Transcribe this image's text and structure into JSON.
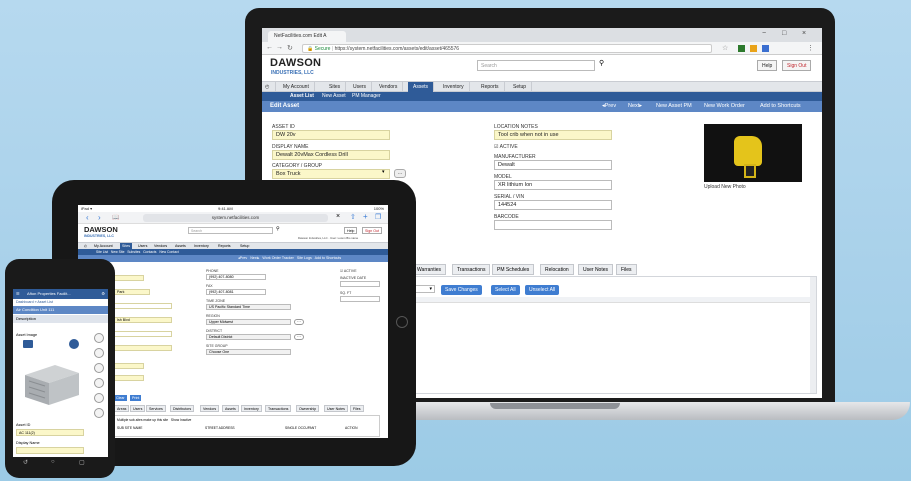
{
  "laptop": {
    "browser": {
      "tab_title": "NetFacilities.com Edit A",
      "url_secure": "Secure",
      "url": "https://system.netfacilities.com/assets/edit/asset/465576",
      "win_min": "−",
      "win_max": "□",
      "win_close": "×"
    },
    "header": {
      "logo_line1": "DAWSON",
      "logo_line2": "INDUSTRIES, LLC",
      "search_placeholder": "Search",
      "help": "Help",
      "sign_out": "Sign Out"
    },
    "nav_tabs": [
      "My Account",
      "Sites",
      "Users",
      "Vendors",
      "Assets",
      "Inventory",
      "Reports",
      "Setup"
    ],
    "subnav": [
      "Asset List",
      "New Asset",
      "PM Manager"
    ],
    "title_bar": {
      "title": "Edit Asset",
      "prev": "◂Prev",
      "next": "Next▸",
      "new_asset_pm": "New Asset PM",
      "new_work_order": "New Work Order",
      "add_shortcuts": "Add to Shortcuts"
    },
    "form": {
      "asset_id_label": "ASSET ID",
      "asset_id": "DW 20v",
      "display_name_label": "DISPLAY NAME",
      "display_name": "Dewalt 20vMax Cordless Drill",
      "category_label": "CATEGORY / GROUP",
      "category": "Box Truck",
      "location_notes_label": "LOCATION NOTES",
      "location_notes": "Tool crib when not in use",
      "active_label": "ACTIVE",
      "manufacturer_label": "MANUFACTURER",
      "manufacturer": "Dewalt",
      "model_label": "MODEL",
      "model": "XR lithium Ion",
      "serial_label": "SERIAL / VIN",
      "serial": "144524",
      "barcode_label": "BARCODE",
      "upload_photo": "Upload New Photo"
    },
    "tabs": [
      "Warranties",
      "Transactions",
      "PM Schedules",
      "Relocation",
      "User Notes",
      "Files"
    ],
    "buttons": {
      "save_changes": "Save Changes",
      "select_all": "Select All",
      "unselect_all": "Unselect All"
    }
  },
  "tablet": {
    "status_time": "9:41 AM",
    "status_left": "iPad ▾",
    "status_right": "100%",
    "url": "system.netfacilities.com",
    "logo_line1": "DAWSON",
    "logo_line2": "INDUSTRIES, LLC",
    "search_placeholder": "Search",
    "help": "Help",
    "sign_out": "Sign Out",
    "account_line": "Dawson Industries, LLC · User: Lorem Bio name",
    "nav": [
      "My Account",
      "Sites",
      "Users",
      "Vendors",
      "Assets",
      "Inventory",
      "Reports",
      "Setup"
    ],
    "subnav": "Site List   New Site   Subsites   Contacts   New Contact",
    "title_links": "◂Prev   Next▸   Work Order Tracker   Site Logs   Add to Shortcuts",
    "fields": {
      "phone_label": "PHONE",
      "phone": "(992) 407-8080",
      "fax_label": "FAX",
      "fax": "(992) 407-8081",
      "timezone_label": "TIME ZONE",
      "timezone": "US Pacific Standard Time",
      "region_label": "REGION",
      "region": "Upper Midwest",
      "district_label": "DISTRICT",
      "district": "Default District",
      "site_group_label": "SITE GROUP",
      "site_group": "Choose One",
      "active_label": "ACTIVE",
      "inactive_date_label": "INACTIVE DATE",
      "sqft_label": "SQ. FT",
      "left_vals": [
        "Park",
        "Ish Blvd"
      ]
    },
    "buttons": [
      "Clear",
      "Print"
    ],
    "tabs": [
      "Areas",
      "Users",
      "Services",
      "Distributors",
      "Vendors",
      "Assets",
      "Inventory",
      "Transactions",
      "Ownership",
      "User Notes",
      "Files"
    ],
    "grid_note": "Multiple sub-sites make up this site   Show Inactive",
    "grid_headers": [
      "SUB SITE NAME",
      "STREET ADDRESS",
      "SINGLE OCCUPANT",
      "ACTION"
    ]
  },
  "phone": {
    "header": "Afton Properties Facilit...",
    "crumb": "Dashboard » Asset List",
    "title": "Air Condition Unit 111",
    "section": "Description",
    "asset_image_label": "Asset Image",
    "asset_id_label": "Asset ID",
    "asset_id": "AC 111(2)",
    "display_name_label": "Display Name",
    "nav": [
      "↺",
      "○",
      "▢"
    ]
  }
}
